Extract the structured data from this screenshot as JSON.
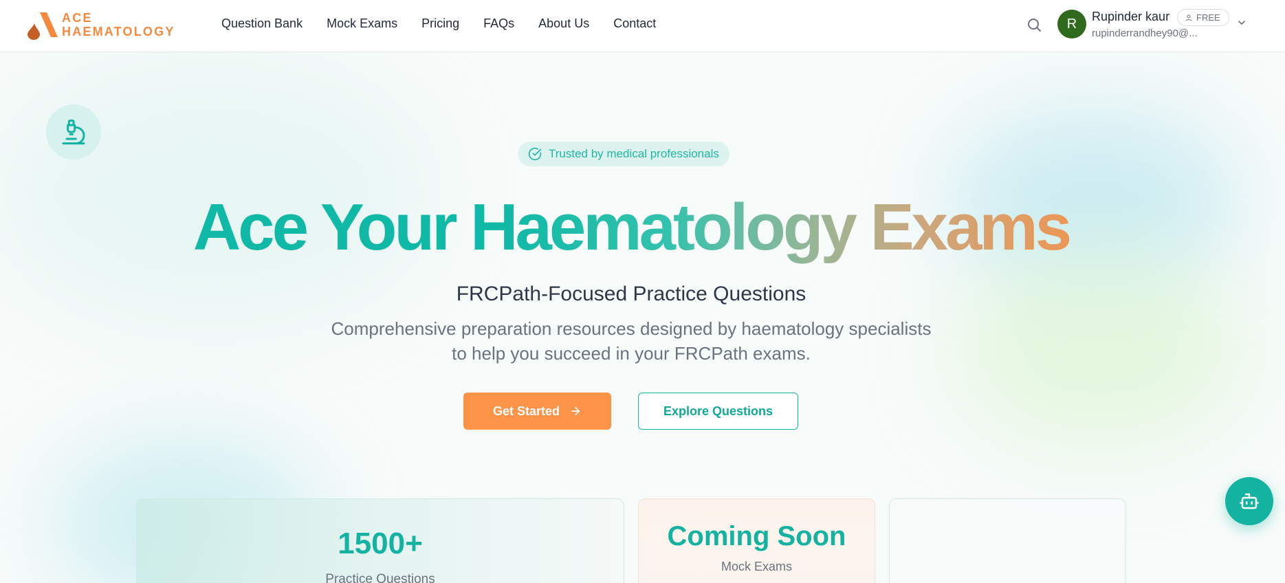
{
  "brand": {
    "line1": "ACE",
    "line2": "HAEMATOLOGY",
    "color": "#f5893f"
  },
  "nav": {
    "items": [
      {
        "label": "Question Bank"
      },
      {
        "label": "Mock Exams"
      },
      {
        "label": "Pricing"
      },
      {
        "label": "FAQs"
      },
      {
        "label": "About Us"
      },
      {
        "label": "Contact"
      }
    ]
  },
  "user": {
    "initial": "R",
    "name": "Rupinder kaur",
    "email": "rupinderrandhey90@...",
    "plan": "FREE",
    "avatar_color": "#2f6a1e"
  },
  "hero": {
    "badge": "Trusted by medical professionals",
    "title": "Ace Your Haematology Exams",
    "subtitle": "FRCPath-Focused Practice Questions",
    "description_line1": "Comprehensive preparation resources designed by haematology specialists",
    "description_line2": "to help you succeed in your FRCPath exams.",
    "primary_cta": "Get Started",
    "secondary_cta": "Explore Questions"
  },
  "stats": {
    "card1": {
      "value": "1500+",
      "label": "Practice Questions"
    },
    "card2": {
      "value": "Coming Soon",
      "label": "Mock Exams"
    },
    "card3": {
      "value": "",
      "label": ""
    }
  },
  "colors": {
    "accent_teal": "#14b3a1",
    "accent_orange": "#fb9348"
  },
  "icons": {
    "search": "search-icon",
    "chevron": "chevron-down-icon",
    "badge_check": "check-circle-icon",
    "lab": "microscope-icon",
    "cta_arrow": "arrow-right-icon",
    "bot": "bot-icon",
    "plan_user": "user-icon"
  }
}
